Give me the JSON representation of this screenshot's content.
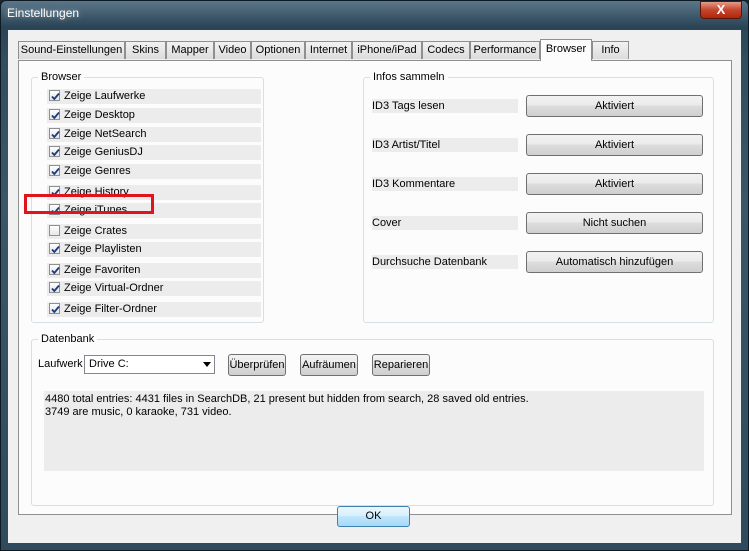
{
  "window": {
    "title": "Einstellungen",
    "close_glyph": "X"
  },
  "tabs": [
    {
      "label": "Sound-Einstellungen"
    },
    {
      "label": "Skins"
    },
    {
      "label": "Mapper"
    },
    {
      "label": "Video"
    },
    {
      "label": "Optionen"
    },
    {
      "label": "Internet"
    },
    {
      "label": "iPhone/iPad"
    },
    {
      "label": "Codecs"
    },
    {
      "label": "Performance"
    },
    {
      "label": "Browser"
    },
    {
      "label": "Info"
    }
  ],
  "active_tab": "Browser",
  "browser_group": {
    "title": "Browser",
    "items": [
      {
        "label": "Zeige Laufwerke",
        "checked": true
      },
      {
        "label": "Zeige Desktop",
        "checked": true
      },
      {
        "label": "Zeige NetSearch",
        "checked": true
      },
      {
        "label": "Zeige GeniusDJ",
        "checked": true
      },
      {
        "label": "Zeige Genres",
        "checked": true
      },
      {
        "label": "Zeige History",
        "checked": true
      },
      {
        "label": "Zeige iTunes",
        "checked": true
      },
      {
        "label": "Zeige Crates",
        "checked": false
      },
      {
        "label": "Zeige Playlisten",
        "checked": true
      },
      {
        "label": "Zeige Favoriten",
        "checked": true
      },
      {
        "label": "Zeige Virtual-Ordner",
        "checked": true
      },
      {
        "label": "Zeige Filter-Ordner",
        "checked": true
      }
    ]
  },
  "info_group": {
    "title": "Infos sammeln",
    "rows": [
      {
        "label": "ID3 Tags lesen",
        "button": "Aktiviert"
      },
      {
        "label": "ID3 Artist/Titel",
        "button": "Aktiviert"
      },
      {
        "label": "ID3 Kommentare",
        "button": "Aktiviert"
      },
      {
        "label": "Cover",
        "button": "Nicht suchen"
      },
      {
        "label": "Durchsuche Datenbank",
        "button": "Automatisch hinzufügen"
      }
    ]
  },
  "db_group": {
    "title": "Datenbank",
    "drive_label": "Laufwerk",
    "drive_value": "Drive C:",
    "check_button": "Überprüfen",
    "cleanup_button": "Aufräumen",
    "repair_button": "Reparieren",
    "stats_line1": "4480 total entries: 4431 files in SearchDB, 21 present but hidden from search, 28 saved old entries.",
    "stats_line2": "3749 are music, 0 karaoke, 731 video."
  },
  "ok_button": "OK",
  "colors": {
    "highlight": "#e0141e",
    "check": "#1c3b7a"
  }
}
